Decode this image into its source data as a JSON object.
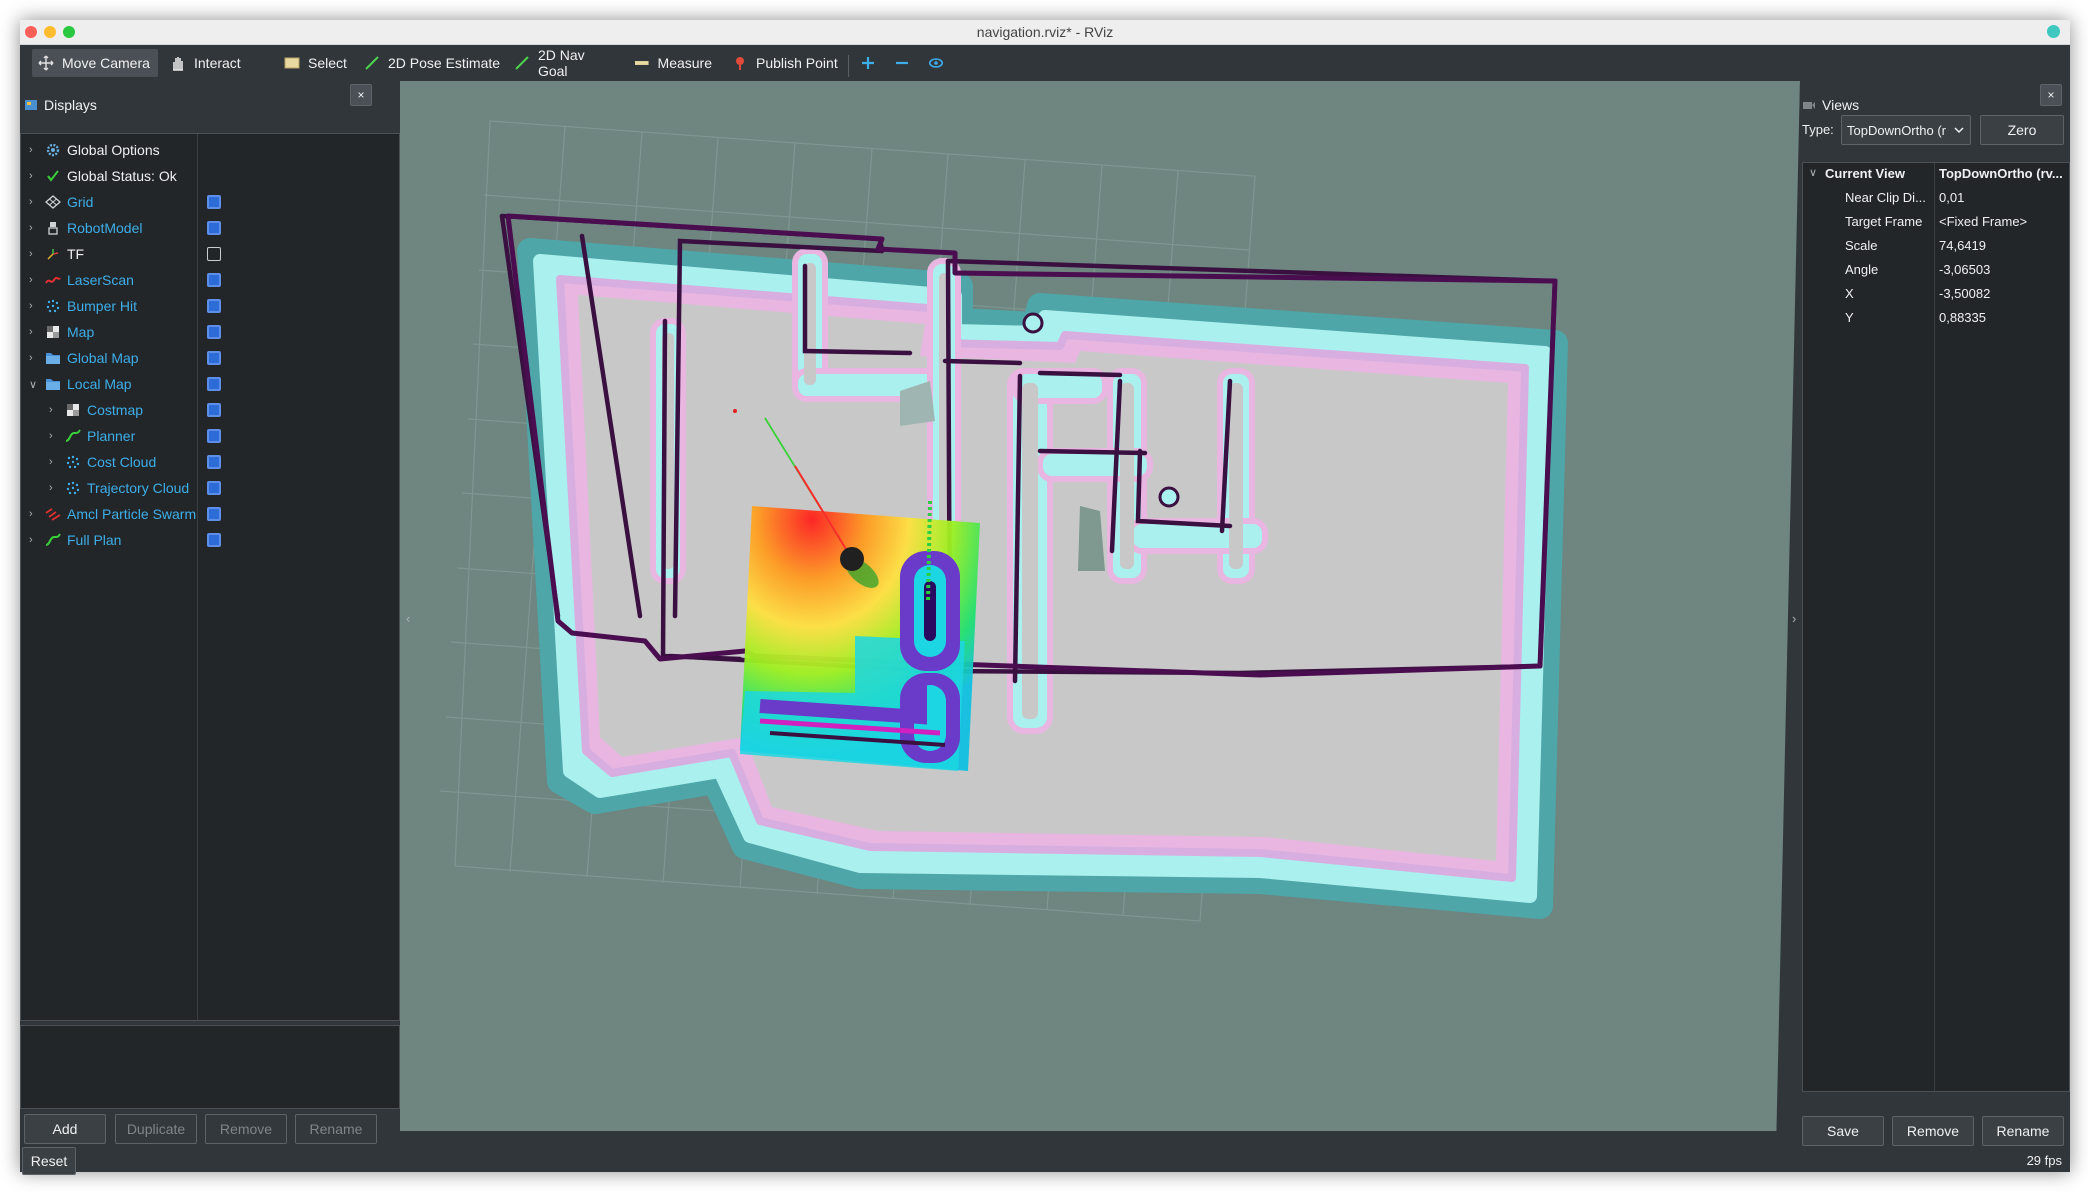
{
  "window": {
    "title": "navigation.rviz* - RViz"
  },
  "toolbar": {
    "tools": [
      {
        "label": "Move Camera",
        "icon": "move-camera-icon",
        "active": true
      },
      {
        "label": "Interact",
        "icon": "hand-icon"
      },
      {
        "label": "Select",
        "icon": "select-icon"
      },
      {
        "label": "2D Pose Estimate",
        "icon": "arrow-green-icon"
      },
      {
        "label": "2D Nav Goal",
        "icon": "arrow-green-icon"
      },
      {
        "label": "Measure",
        "icon": "ruler-icon"
      },
      {
        "label": "Publish Point",
        "icon": "pin-icon"
      }
    ],
    "zoom_in": "+",
    "zoom_out": "−"
  },
  "displays": {
    "title": "Displays",
    "close": "×",
    "items": [
      {
        "label": "Global Options",
        "style": "white",
        "icon": "gear-icon",
        "checkbox": null,
        "indent": 0,
        "expanded": false
      },
      {
        "label": "Global Status: Ok",
        "style": "white",
        "icon": "check-icon",
        "checkbox": null,
        "indent": 0,
        "expanded": false
      },
      {
        "label": "Grid",
        "style": "blue",
        "icon": "grid-icon",
        "checkbox": true,
        "indent": 0,
        "expanded": false
      },
      {
        "label": "RobotModel",
        "style": "blue",
        "icon": "robot-icon",
        "checkbox": true,
        "indent": 0,
        "expanded": false
      },
      {
        "label": "TF",
        "style": "white",
        "icon": "tf-icon",
        "checkbox": false,
        "indent": 0,
        "expanded": false
      },
      {
        "label": "LaserScan",
        "style": "blue",
        "icon": "laser-icon",
        "checkbox": true,
        "indent": 0,
        "expanded": false
      },
      {
        "label": "Bumper Hit",
        "style": "blue",
        "icon": "pointcloud-icon",
        "checkbox": true,
        "indent": 0,
        "expanded": false
      },
      {
        "label": "Map",
        "style": "blue",
        "icon": "map-icon",
        "checkbox": true,
        "indent": 0,
        "expanded": false
      },
      {
        "label": "Global Map",
        "style": "blue",
        "icon": "folder-icon",
        "checkbox": true,
        "indent": 0,
        "expanded": false
      },
      {
        "label": "Local Map",
        "style": "blue",
        "icon": "folder-icon",
        "checkbox": true,
        "indent": 0,
        "expanded": true
      },
      {
        "label": "Costmap",
        "style": "blue",
        "icon": "map-icon",
        "checkbox": true,
        "indent": 1,
        "expanded": false
      },
      {
        "label": "Planner",
        "style": "blue",
        "icon": "path-icon",
        "checkbox": true,
        "indent": 1,
        "expanded": false
      },
      {
        "label": "Cost Cloud",
        "style": "blue",
        "icon": "pointcloud-icon",
        "checkbox": true,
        "indent": 1,
        "expanded": false
      },
      {
        "label": "Trajectory Cloud",
        "style": "blue",
        "icon": "pointcloud-icon",
        "checkbox": true,
        "indent": 1,
        "expanded": false
      },
      {
        "label": "Amcl Particle Swarm",
        "style": "blue",
        "icon": "pose-array-icon",
        "checkbox": true,
        "indent": 0,
        "expanded": false
      },
      {
        "label": "Full Plan",
        "style": "blue",
        "icon": "path-icon",
        "checkbox": true,
        "indent": 0,
        "expanded": false
      }
    ],
    "buttons": {
      "add": "Add",
      "duplicate": "Duplicate",
      "remove": "Remove",
      "rename": "Rename"
    }
  },
  "views": {
    "title": "Views",
    "close": "×",
    "type_label": "Type:",
    "type_value": "TopDownOrtho (r",
    "zero": "Zero",
    "current_view": {
      "label": "Current View",
      "value": "TopDownOrtho (rv..."
    },
    "properties": [
      {
        "key": "Near Clip Di...",
        "value": "0,01"
      },
      {
        "key": "Target Frame",
        "value": "<Fixed Frame>"
      },
      {
        "key": "Scale",
        "value": "74,6419"
      },
      {
        "key": "Angle",
        "value": "-3,06503"
      },
      {
        "key": "X",
        "value": "-3,50082"
      },
      {
        "key": "Y",
        "value": "0,88335"
      }
    ],
    "buttons": {
      "save": "Save",
      "remove": "Remove",
      "rename": "Rename"
    }
  },
  "status": {
    "reset": "Reset",
    "fps": "29 fps"
  }
}
